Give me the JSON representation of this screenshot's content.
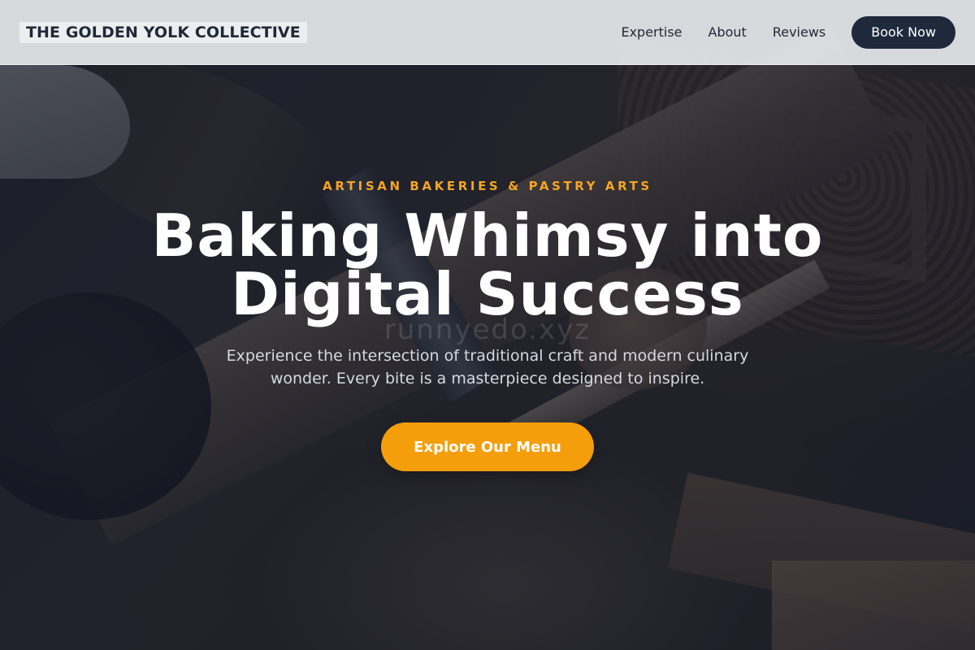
{
  "navbar": {
    "brand": "THE GOLDEN YOLK COLLECTIVE",
    "links": [
      {
        "label": "Expertise"
      },
      {
        "label": "About"
      },
      {
        "label": "Reviews"
      }
    ],
    "cta_label": "Book Now"
  },
  "hero": {
    "eyebrow": "ARTISAN BAKERIES & PASTRY ARTS",
    "headline_line1": "Baking Whimsy into",
    "headline_line2": "Digital Success",
    "subtext": "Experience the intersection of traditional craft and modern culinary wonder. Every bite is a masterpiece designed to inspire.",
    "cta_label": "Explore Our Menu",
    "watermark": "runnyedo.xyz"
  },
  "colors": {
    "accent": "#f59e0b",
    "eyebrow": "#f5a524",
    "nav_button": "#1e293b",
    "navbar_bg": "#e5e7eb",
    "overlay": "#111827"
  }
}
